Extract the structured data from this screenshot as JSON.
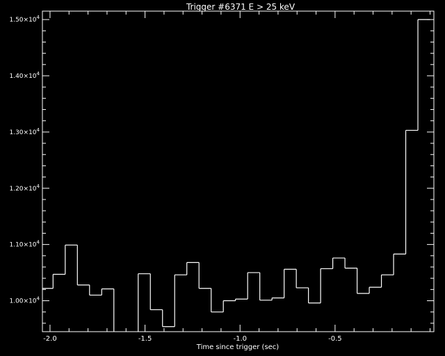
{
  "chart_data": {
    "type": "line",
    "style": "step",
    "title": "Trigger #6371  E > 25 keV",
    "xlabel": "Time since trigger (sec)",
    "ylabel": "",
    "xlim": [
      -2.04,
      0.02
    ],
    "ylim": [
      9450,
      15150
    ],
    "x_ticks": [
      {
        "value": -2.0,
        "label": "-2.0"
      },
      {
        "value": -1.5,
        "label": "-1.5"
      },
      {
        "value": -1.0,
        "label": "-1.0"
      },
      {
        "value": -0.5,
        "label": "-0.5"
      }
    ],
    "x_minor_step": 0.1,
    "y_ticks": [
      {
        "value": 10000,
        "mantissa": "1.00",
        "exp": "4"
      },
      {
        "value": 11000,
        "mantissa": "1.10",
        "exp": "4"
      },
      {
        "value": 12000,
        "mantissa": "1.20",
        "exp": "4"
      },
      {
        "value": 13000,
        "mantissa": "1.30",
        "exp": "4"
      },
      {
        "value": 14000,
        "mantissa": "1.40",
        "exp": "4"
      },
      {
        "value": 15000,
        "mantissa": "1.50",
        "exp": "4"
      }
    ],
    "y_minor_step": 200,
    "bin_width": 0.064,
    "bin_edges": [
      -2.048,
      -1.984,
      -1.92,
      -1.856,
      -1.792,
      -1.728,
      -1.664,
      -1.6,
      -1.536,
      -1.472,
      -1.408,
      -1.344,
      -1.28,
      -1.216,
      -1.152,
      -1.088,
      -1.024,
      -0.96,
      -0.896,
      -0.832,
      -0.768,
      -0.704,
      -0.64,
      -0.576,
      -0.512,
      -0.448,
      -0.384,
      -0.32,
      -0.256,
      -0.192,
      -0.128,
      -0.064,
      0.0
    ],
    "values": [
      10220,
      10470,
      10990,
      10280,
      10100,
      10210,
      9150,
      9200,
      10480,
      9840,
      9540,
      10460,
      10680,
      10220,
      9800,
      10000,
      10030,
      10500,
      10010,
      10050,
      10560,
      10230,
      9960,
      10570,
      10760,
      10580,
      10130,
      10240,
      10460,
      10830,
      13030,
      15000
    ],
    "grid": false
  }
}
